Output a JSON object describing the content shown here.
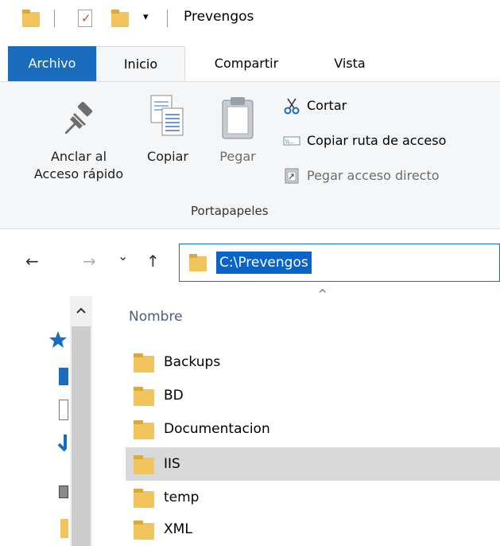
{
  "window": {
    "title": "Prevengos",
    "quick_access_dropdown": "▾"
  },
  "tabs": [
    {
      "label": "Archivo"
    },
    {
      "label": "Inicio"
    },
    {
      "label": "Compartir"
    },
    {
      "label": "Vista"
    }
  ],
  "ribbon": {
    "pin_label_line1": "Anclar al",
    "pin_label_line2": "Acceso rápido",
    "copy_label": "Copiar",
    "paste_label": "Pegar",
    "cut_label": "Cortar",
    "copy_path_label": "Copiar ruta de acceso",
    "paste_shortcut_label": "Pegar acceso directo",
    "group_label": "Portapapeles"
  },
  "navigation": {
    "back": "←",
    "forward": "→",
    "recent": "⌄",
    "up": "↑"
  },
  "address": {
    "path": "C:\\Prevengos"
  },
  "list": {
    "column_name": "Nombre",
    "sort_indicator": "^",
    "items": [
      {
        "name": "Backups"
      },
      {
        "name": "BD"
      },
      {
        "name": "Documentacion"
      },
      {
        "name": "IIS"
      },
      {
        "name": "temp"
      },
      {
        "name": "XML"
      }
    ]
  },
  "colors": {
    "accent": "#1a6dbd",
    "folder": "#f2c55c",
    "selection": "#d9d9d9",
    "ribbon_bg": "#f5f6f7"
  }
}
